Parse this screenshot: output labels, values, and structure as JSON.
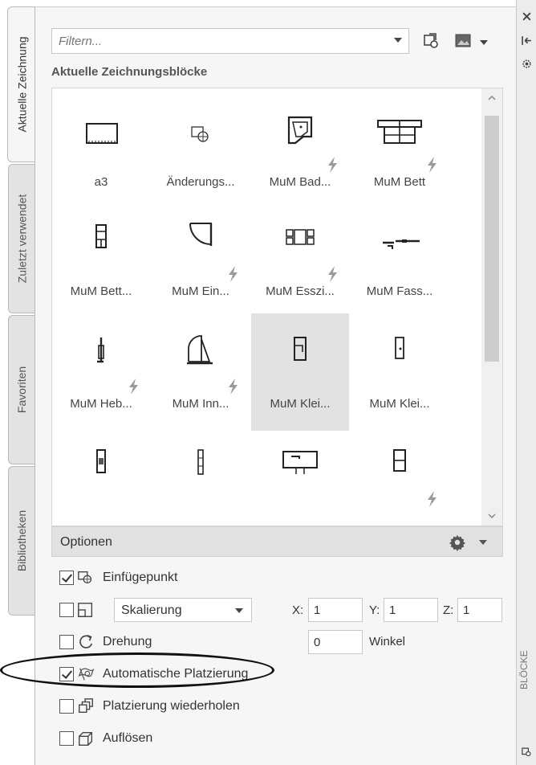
{
  "tabs": [
    {
      "label": "Aktuelle Zeichnung",
      "active": true
    },
    {
      "label": "Zuletzt verwendet",
      "active": false
    },
    {
      "label": "Favoriten",
      "active": false
    },
    {
      "label": "Bibliotheken",
      "active": false
    }
  ],
  "filter": {
    "placeholder": "Filtern..."
  },
  "section_title": "Aktuelle Zeichnungsblöcke",
  "blocks": [
    {
      "label": "a3",
      "icon": "rectangle-block-icon",
      "dynamic": false
    },
    {
      "label": "Änderungs...",
      "icon": "insert-point-block-icon",
      "dynamic": false
    },
    {
      "label": "MuM Bad...",
      "icon": "bathtub-block-icon",
      "dynamic": true
    },
    {
      "label": "MuM Bett",
      "icon": "bed-block-icon",
      "dynamic": true
    },
    {
      "label": "MuM Bett...",
      "icon": "bed-small-block-icon",
      "dynamic": false
    },
    {
      "label": "MuM Ein...",
      "icon": "door-swing-block-icon",
      "dynamic": true
    },
    {
      "label": "MuM Esszi...",
      "icon": "dining-table-block-icon",
      "dynamic": true
    },
    {
      "label": "MuM Fass...",
      "icon": "facade-block-icon",
      "dynamic": false
    },
    {
      "label": "MuM Heb...",
      "icon": "lift-block-icon",
      "dynamic": true
    },
    {
      "label": "MuM Inn...",
      "icon": "inner-door-block-icon",
      "dynamic": true
    },
    {
      "label": "MuM Klei...",
      "icon": "wardrobe-block-icon",
      "dynamic": false
    },
    {
      "label": "MuM Klei...",
      "icon": "cabinet-block-icon",
      "dynamic": false
    },
    {
      "label": "",
      "icon": "column-block-icon",
      "dynamic": false
    },
    {
      "label": "",
      "icon": "pipe-block-icon",
      "dynamic": false
    },
    {
      "label": "",
      "icon": "sink-block-icon",
      "dynamic": false
    },
    {
      "label": "",
      "icon": "shelf-block-icon",
      "dynamic": true
    }
  ],
  "options": {
    "title": "Optionen",
    "insertion_point": {
      "label": "Einfügepunkt",
      "checked": true
    },
    "scale": {
      "checked": false,
      "mode": "Skalierung",
      "x_label": "X:",
      "x": "1",
      "y_label": "Y:",
      "y": "1",
      "z_label": "Z:",
      "z": "1"
    },
    "rotation": {
      "label": "Drehung",
      "checked": false,
      "value": "0",
      "unit_label": "Winkel"
    },
    "auto_placement": {
      "label": "Automatische Platzierung",
      "checked": true
    },
    "repeat_placement": {
      "label": "Platzierung wiederholen",
      "checked": false
    },
    "explode": {
      "label": "Auflösen",
      "checked": false
    }
  },
  "side_strip_label": "BLÖCKE"
}
